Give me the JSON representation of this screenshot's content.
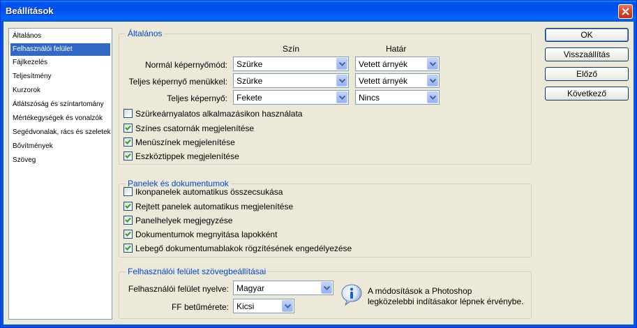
{
  "window": {
    "title": "Beállítások",
    "close_icon": "close-icon"
  },
  "sidebar": {
    "items": [
      {
        "label": "Általános",
        "selected": false
      },
      {
        "label": "Felhasználói felület",
        "selected": true
      },
      {
        "label": "Fájlkezelés",
        "selected": false
      },
      {
        "label": "Teljesítmény",
        "selected": false
      },
      {
        "label": "Kurzorok",
        "selected": false
      },
      {
        "label": "Átlátszóság és színtartomány",
        "selected": false
      },
      {
        "label": "Mértékegységek és vonalzók",
        "selected": false
      },
      {
        "label": "Segédvonalak, rács és szeletek",
        "selected": false
      },
      {
        "label": "Bővítmények",
        "selected": false
      },
      {
        "label": "Szöveg",
        "selected": false
      }
    ]
  },
  "general": {
    "title": "Általános",
    "col_color": "Szín",
    "col_border": "Határ",
    "rows": [
      {
        "label": "Normál képernyőmód:",
        "color": "Szürke",
        "border": "Vetett árnyék"
      },
      {
        "label": "Teljes képernyő menükkel:",
        "color": "Szürke",
        "border": "Vetett árnyék"
      },
      {
        "label": "Teljes képernyő:",
        "color": "Fekete",
        "border": "Nincs"
      }
    ],
    "checkboxes": [
      {
        "label": "Szürkeárnyalatos alkalmazásikon használata",
        "checked": false
      },
      {
        "label": "Színes csatornák megjelenítése",
        "checked": true
      },
      {
        "label": "Menüszínek megjelenítése",
        "checked": true
      },
      {
        "label": "Eszköztippek megjelenítése",
        "checked": true
      }
    ]
  },
  "panels": {
    "title": "Panelek és dokumentumok",
    "checkboxes": [
      {
        "label": "Ikonpanelek automatikus összecsukása",
        "checked": false
      },
      {
        "label": "Rejtett panelek automatikus megjelenítése",
        "checked": true
      },
      {
        "label": "Panelhelyek megjegyzése",
        "checked": true
      },
      {
        "label": "Dokumentumok megnyitása lapokként",
        "checked": true
      },
      {
        "label": "Lebegő dokumentumablakok rögzítésének engedélyezése",
        "checked": true
      }
    ]
  },
  "text_options": {
    "title": "Felhasználói felület szövegbeállításai",
    "language_label": "Felhasználói felület nyelve:",
    "language_value": "Magyar",
    "font_size_label": "FF betűmérete:",
    "font_size_value": "Kicsi",
    "info_line1": "A módosítások a Photoshop",
    "info_line2": "legközelebbi indításakor lépnek érvénybe."
  },
  "buttons": {
    "ok": "OK",
    "reset": "Visszaállítás",
    "prev": "Előző",
    "next": "Következő"
  },
  "colors": {
    "accent": "#316ac5",
    "group_title": "#0046d5",
    "window_bg": "#ece9d8"
  }
}
